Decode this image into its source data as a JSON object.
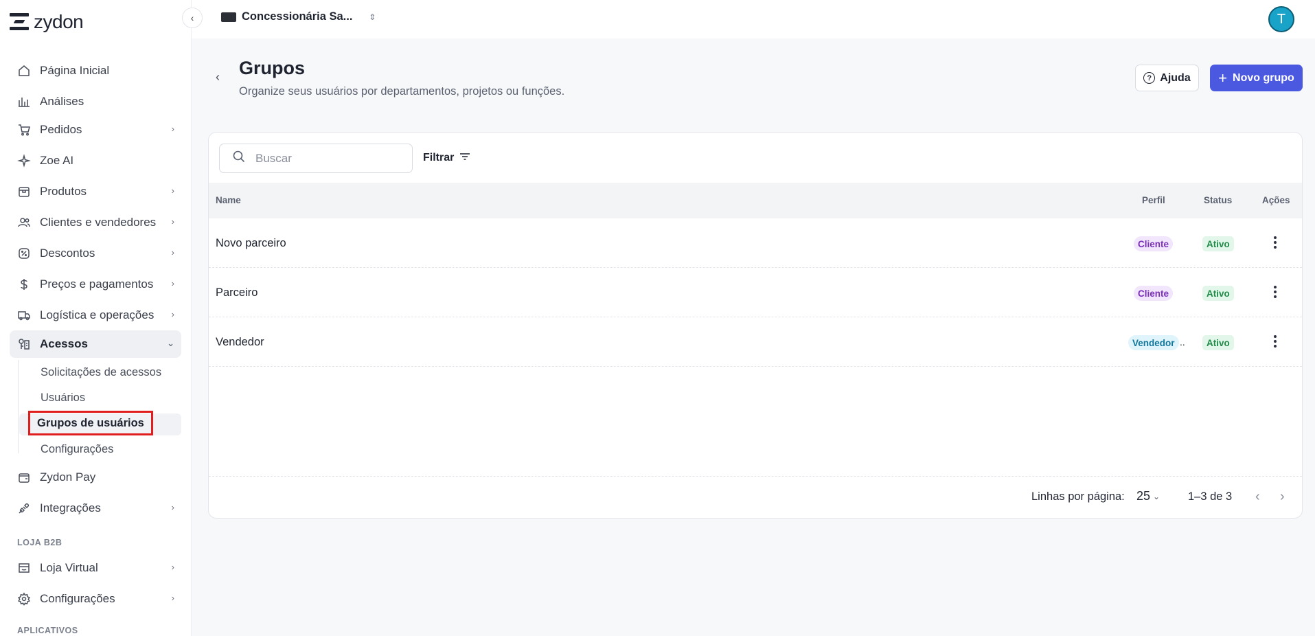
{
  "app": {
    "name": "zydon"
  },
  "topbar": {
    "company": "Concessionária Sa...",
    "avatar_initial": "T"
  },
  "sidebar": {
    "items": [
      {
        "label": "Página Inicial",
        "icon": "home-icon"
      },
      {
        "label": "Análises",
        "icon": "chart-icon"
      },
      {
        "label": "Pedidos",
        "icon": "cart-icon"
      },
      {
        "label": "Zoe AI",
        "icon": "sparkle-icon"
      },
      {
        "label": "Produtos",
        "icon": "box-icon"
      },
      {
        "label": "Clientes e vendedores",
        "icon": "users-icon"
      },
      {
        "label": "Descontos",
        "icon": "discount-icon"
      },
      {
        "label": "Preços e pagamentos",
        "icon": "dollar-icon"
      },
      {
        "label": "Logística e operações",
        "icon": "truck-icon"
      },
      {
        "label": "Acessos",
        "icon": "access-icon"
      },
      {
        "label": "Zydon Pay",
        "icon": "wallet-icon"
      },
      {
        "label": "Integrações",
        "icon": "plug-icon"
      },
      {
        "label": "Loja Virtual",
        "icon": "store-icon"
      },
      {
        "label": "Configurações",
        "icon": "gear-icon"
      }
    ],
    "sub_items": [
      "Solicitações de acessos",
      "Usuários",
      "Grupos de usuários",
      "Configurações"
    ],
    "section_loja": "LOJA B2B",
    "section_apps": "APLICATIVOS"
  },
  "header": {
    "title": "Grupos",
    "subtitle": "Organize seus usuários por departamentos, projetos ou funções.",
    "help_label": "Ajuda",
    "new_label": "Novo grupo"
  },
  "toolbar": {
    "search_placeholder": "Buscar",
    "filter_label": "Filtrar"
  },
  "table": {
    "columns": [
      "Name",
      "Perfil",
      "Status",
      "Ações"
    ],
    "rows": [
      {
        "name": "Novo parceiro",
        "perfil": "Cliente",
        "status": "Ativo"
      },
      {
        "name": "Parceiro",
        "perfil": "Cliente",
        "status": "Ativo"
      },
      {
        "name": "Vendedor",
        "perfil": "Vendedor",
        "perfil_more": "..",
        "status": "Ativo"
      }
    ]
  },
  "pagination": {
    "rows_label": "Linhas por página:",
    "rows_value": "25",
    "range": "1–3 de 3"
  },
  "colors": {
    "primary": "#4a59e0",
    "highlight": "#e01e1e",
    "avatar": "#1aa3c9"
  }
}
